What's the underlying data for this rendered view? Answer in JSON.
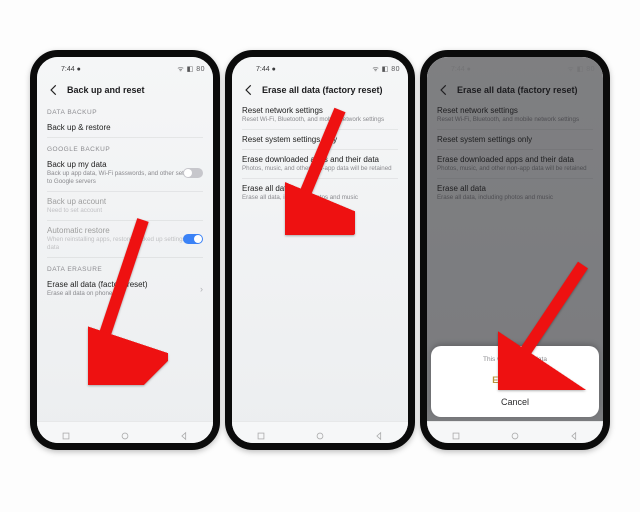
{
  "status": {
    "time": "7:44",
    "ampm": "●",
    "right": "ᯤ ◧ 80"
  },
  "phone1": {
    "header": "Back up and reset",
    "sec_backup": "DATA BACKUP",
    "row_backup": "Back up & restore",
    "sec_google": "GOOGLE BACKUP",
    "row_gbackup_title": "Back up my data",
    "row_gbackup_sub": "Back up app data, Wi-Fi passwords, and other settings to Google servers",
    "row_ac_title": "Back up account",
    "row_ac_sub": "Need to set account",
    "row_ar_title": "Automatic restore",
    "row_ar_sub": "When reinstalling apps, restore backed up settings and data",
    "sec_erase": "DATA ERASURE",
    "row_erase_title": "Erase all data (factory reset)",
    "row_erase_sub": "Erase all data on phone"
  },
  "phone2": {
    "header": "Erase all data (factory reset)",
    "r1_title": "Reset network settings",
    "r1_sub": "Reset Wi-Fi, Bluetooth, and mobile network settings",
    "r2_title": "Reset system settings only",
    "r2_sub": "",
    "r3_title": "Erase downloaded apps and their data",
    "r3_sub": "Photos, music, and other non-app data will be retained",
    "r4_title": "Erase all data",
    "r4_sub": "Erase all data, including photos and music"
  },
  "phone3": {
    "header": "Erase all data (factory reset)",
    "r1_title": "Reset network settings",
    "r1_sub": "Reset Wi-Fi, Bluetooth, and mobile network settings",
    "r2_title": "Reset system settings only",
    "r3_title": "Erase downloaded apps and their data",
    "r3_sub": "Photos, music, and other non-app data will be retained",
    "r4_title": "Erase all data",
    "r4_sub": "Erase all data, including photos and music",
    "sheet_desc": "This will erase all data",
    "sheet_erase": "Erase data",
    "sheet_cancel": "Cancel"
  }
}
